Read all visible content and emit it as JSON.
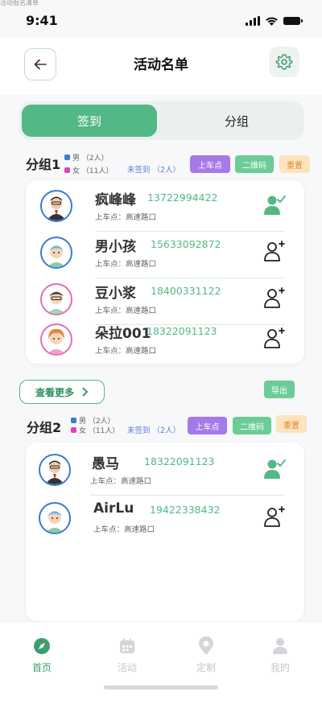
{
  "top_hint": "活动报名清单",
  "status_bar": {
    "time": "9:41"
  },
  "header": {
    "title": "活动名单"
  },
  "tabs": [
    {
      "label": "签到"
    },
    {
      "label": "分组"
    }
  ],
  "groups": [
    {
      "name": "分组1",
      "male": "男 （2人）",
      "female": "女 （11人）",
      "unsigned": "未签到 （2人）",
      "btn_pickup": "上车点",
      "btn_qrcode": "二维码",
      "btn_reset": "重置",
      "members": [
        {
          "name": "疯峰峰",
          "phone": "13722994422",
          "stop": "上车点：高速路口",
          "signed": true,
          "gender": "male"
        },
        {
          "name": "男小孩",
          "phone": "15633092872",
          "stop": "上车点：高速路口",
          "signed": false,
          "gender": "male"
        },
        {
          "name": "豆小浆",
          "phone": "18400331122",
          "stop": "上车点：高速路口",
          "signed": false,
          "gender": "female"
        },
        {
          "name": "朵拉001",
          "phone": "18322091123",
          "stop": "上车点：高速路口",
          "signed": false,
          "gender": "female"
        }
      ]
    },
    {
      "name": "分组2",
      "male": "男 （2人）",
      "female": "女 （11人）",
      "unsigned": "未签到 （2人）",
      "btn_pickup": "上车点",
      "btn_qrcode": "二维码",
      "btn_reset": "重置",
      "members": [
        {
          "name": "愚马",
          "phone": "18322091123",
          "stop": "上车点：高速路口",
          "signed": true,
          "gender": "male"
        },
        {
          "name": "AirLu",
          "phone": "19422338432",
          "stop": "上车点：高速路口",
          "signed": false,
          "gender": "male"
        }
      ]
    }
  ],
  "actions": {
    "more_label": "查看更多",
    "export_label": "导出"
  },
  "bottom_nav": [
    {
      "label": "首页",
      "icon": "compass-icon",
      "active": true
    },
    {
      "label": "活动",
      "icon": "calendar-icon",
      "active": false
    },
    {
      "label": "定制",
      "icon": "location-pin-icon",
      "active": false
    },
    {
      "label": "我的",
      "icon": "user-icon",
      "active": false
    }
  ],
  "colors": {
    "accent": "#52b886",
    "purple": "#a679e8",
    "chip_green": "#6ccc97",
    "chip_orange_bg": "#fde4bf",
    "blue": "#3a7bd5",
    "pink": "#e070b8"
  }
}
